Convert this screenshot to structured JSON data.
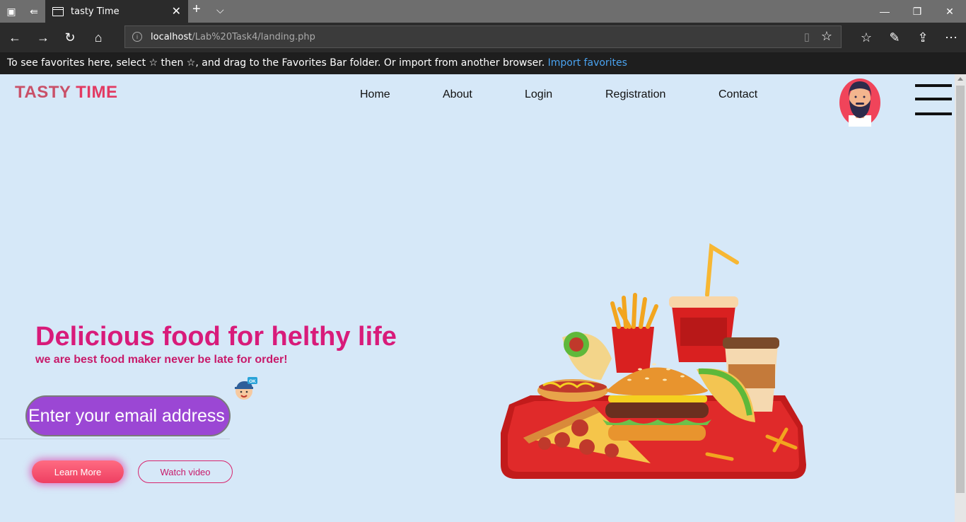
{
  "browser": {
    "tab_title": "tasty Time",
    "url_host": "localhost",
    "url_path": "/Lab%20Task4/landing.php",
    "favorites_message": "To see favorites here, select  ☆  then ☆, and drag to the Favorites Bar folder. Or import from another browser.",
    "import_link": "Import favorites"
  },
  "brand": {
    "part1": "TASTY ",
    "part2": "TIME"
  },
  "nav": {
    "home": "Home",
    "about": "About",
    "login": "Login",
    "registration": "Registration",
    "contact": "Contact"
  },
  "hero": {
    "headline": "Delicious food for helthy life",
    "subline": "we are best food maker never be late for order!",
    "email_placeholder": "Enter your email address",
    "learn_more": "Learn More",
    "watch_video": "Watch video",
    "badge_text": "OK"
  },
  "colors": {
    "page_bg": "#d6e8f8",
    "headline": "#d81b7a",
    "brand": "#e23a62",
    "email_bg": "#9b47d4"
  }
}
